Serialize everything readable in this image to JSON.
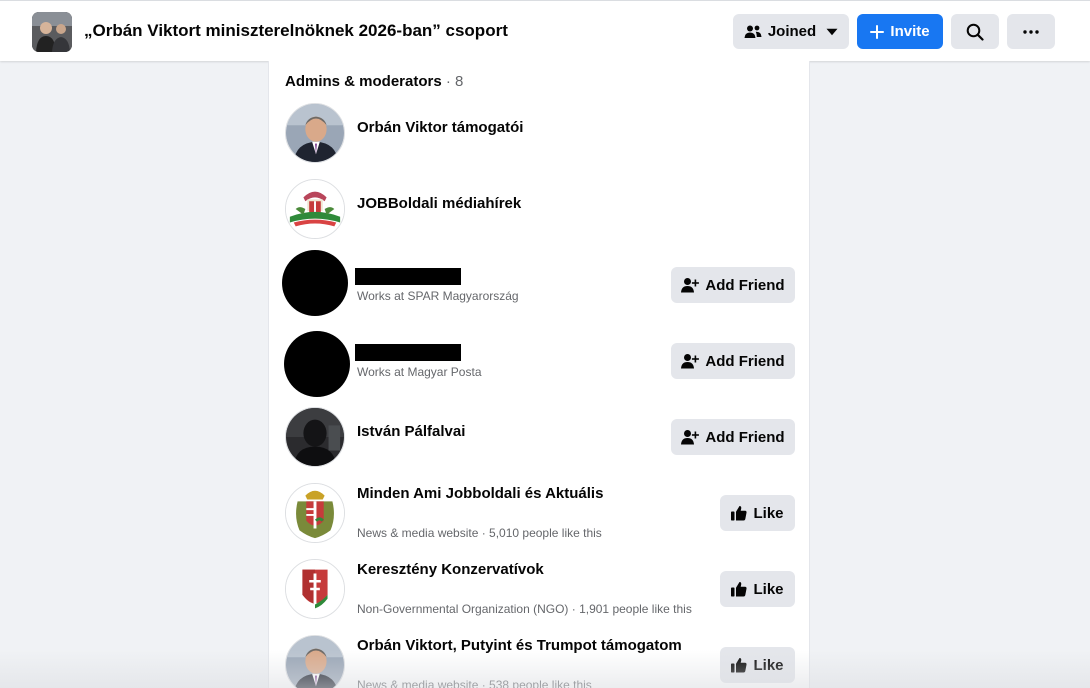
{
  "header": {
    "group_title": "„Orbán Viktort miniszterelnöknek 2026-ban” csoport",
    "joined_label": "Joined",
    "invite_label": "Invite"
  },
  "icons": {
    "group_thumb": "group-photo",
    "joined": "people-icon",
    "joined_caret": "caret-down-icon",
    "invite": "plus-icon",
    "search": "search-icon",
    "more": "ellipsis-icon",
    "add_friend": "add-friend-icon",
    "like": "thumbs-up-icon"
  },
  "colors": {
    "primary": "#1877f2",
    "secondary_button": "#e4e6eb",
    "page_bg": "#f0f2f5",
    "muted_text": "#65676b"
  },
  "section": {
    "title": "Admins & moderators",
    "count": "8"
  },
  "members": [
    {
      "name": "Orbán Viktor támogatói",
      "subtitle": "",
      "action": ""
    },
    {
      "name": "JOBBoldali médiahírek",
      "subtitle": "",
      "action": ""
    },
    {
      "name": "",
      "subtitle": "Works at SPAR Magyarország",
      "action": "Add Friend"
    },
    {
      "name": "",
      "subtitle": "Works at Magyar Posta",
      "action": "Add Friend"
    },
    {
      "name": "István Pálfalvai",
      "subtitle": "",
      "action": "Add Friend"
    },
    {
      "name": "Minden Ami Jobboldali és Aktuális",
      "subtitle": "News & media website · 5,010 people like this",
      "action": "Like"
    },
    {
      "name": "Keresztény Konzervatívok",
      "subtitle": "Non-Governmental Organization (NGO) · 1,901 people like this",
      "action": "Like"
    },
    {
      "name": "Orbán Viktort, Putyint és Trumpot támogatom",
      "subtitle": "News & media website · 538 people like this",
      "action": "Like"
    }
  ]
}
